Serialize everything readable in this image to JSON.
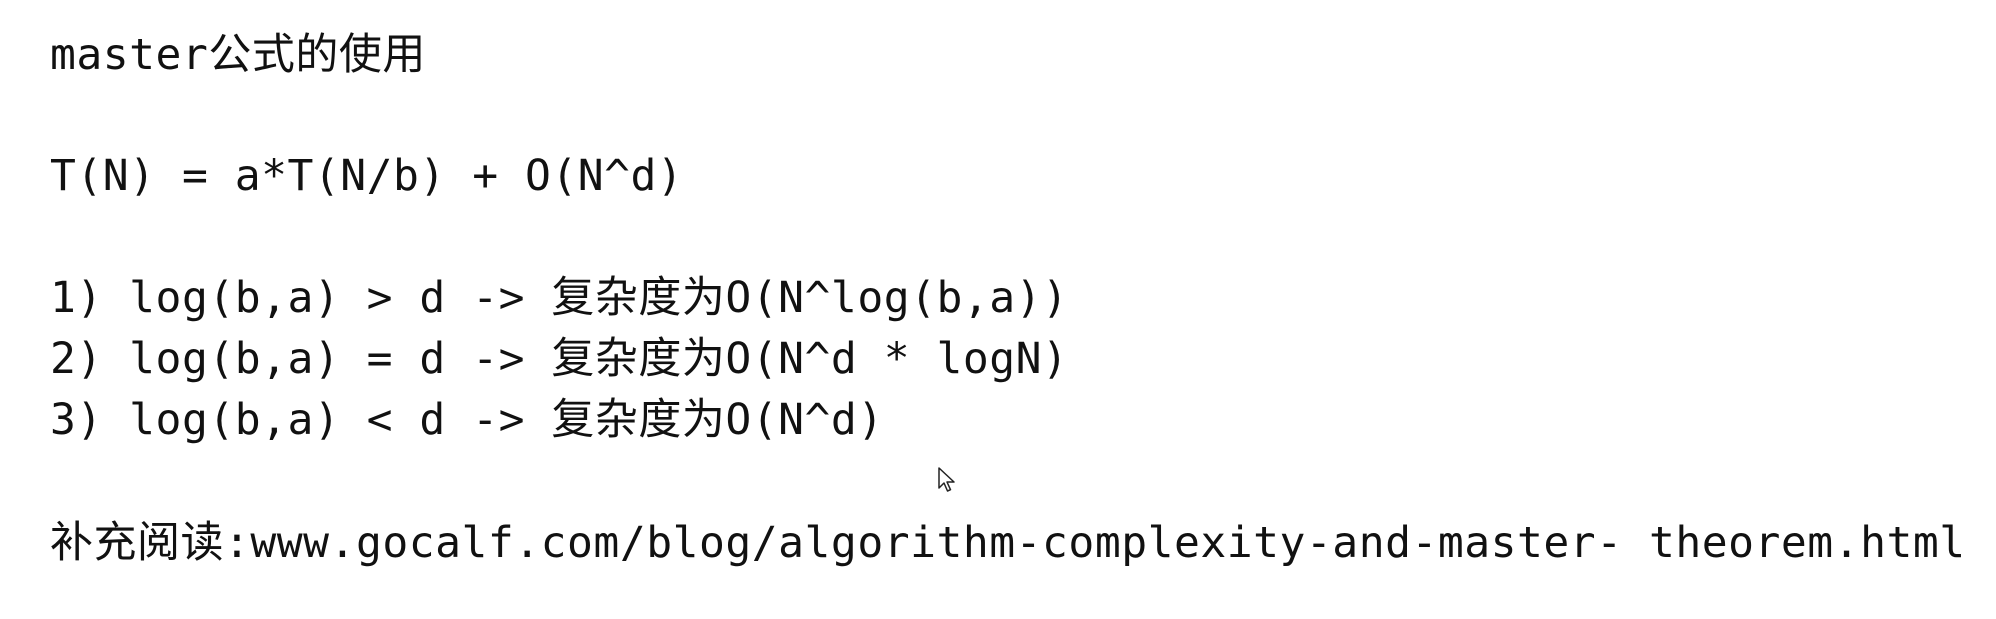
{
  "title": "master公式的使用",
  "formula": "T(N) = a*T(N/b) + O(N^d)",
  "cases": [
    "1) log(b,a) > d -> 复杂度为O(N^log(b,a))",
    "2) log(b,a) = d -> 复杂度为O(N^d * logN)",
    "3) log(b,a) < d -> 复杂度为O(N^d)"
  ],
  "reading": {
    "label": "补充阅读:",
    "url": "www.gocalf.com/blog/algorithm-complexity-and-master- theorem.html"
  },
  "cursor_icon": "arrow-pointer"
}
